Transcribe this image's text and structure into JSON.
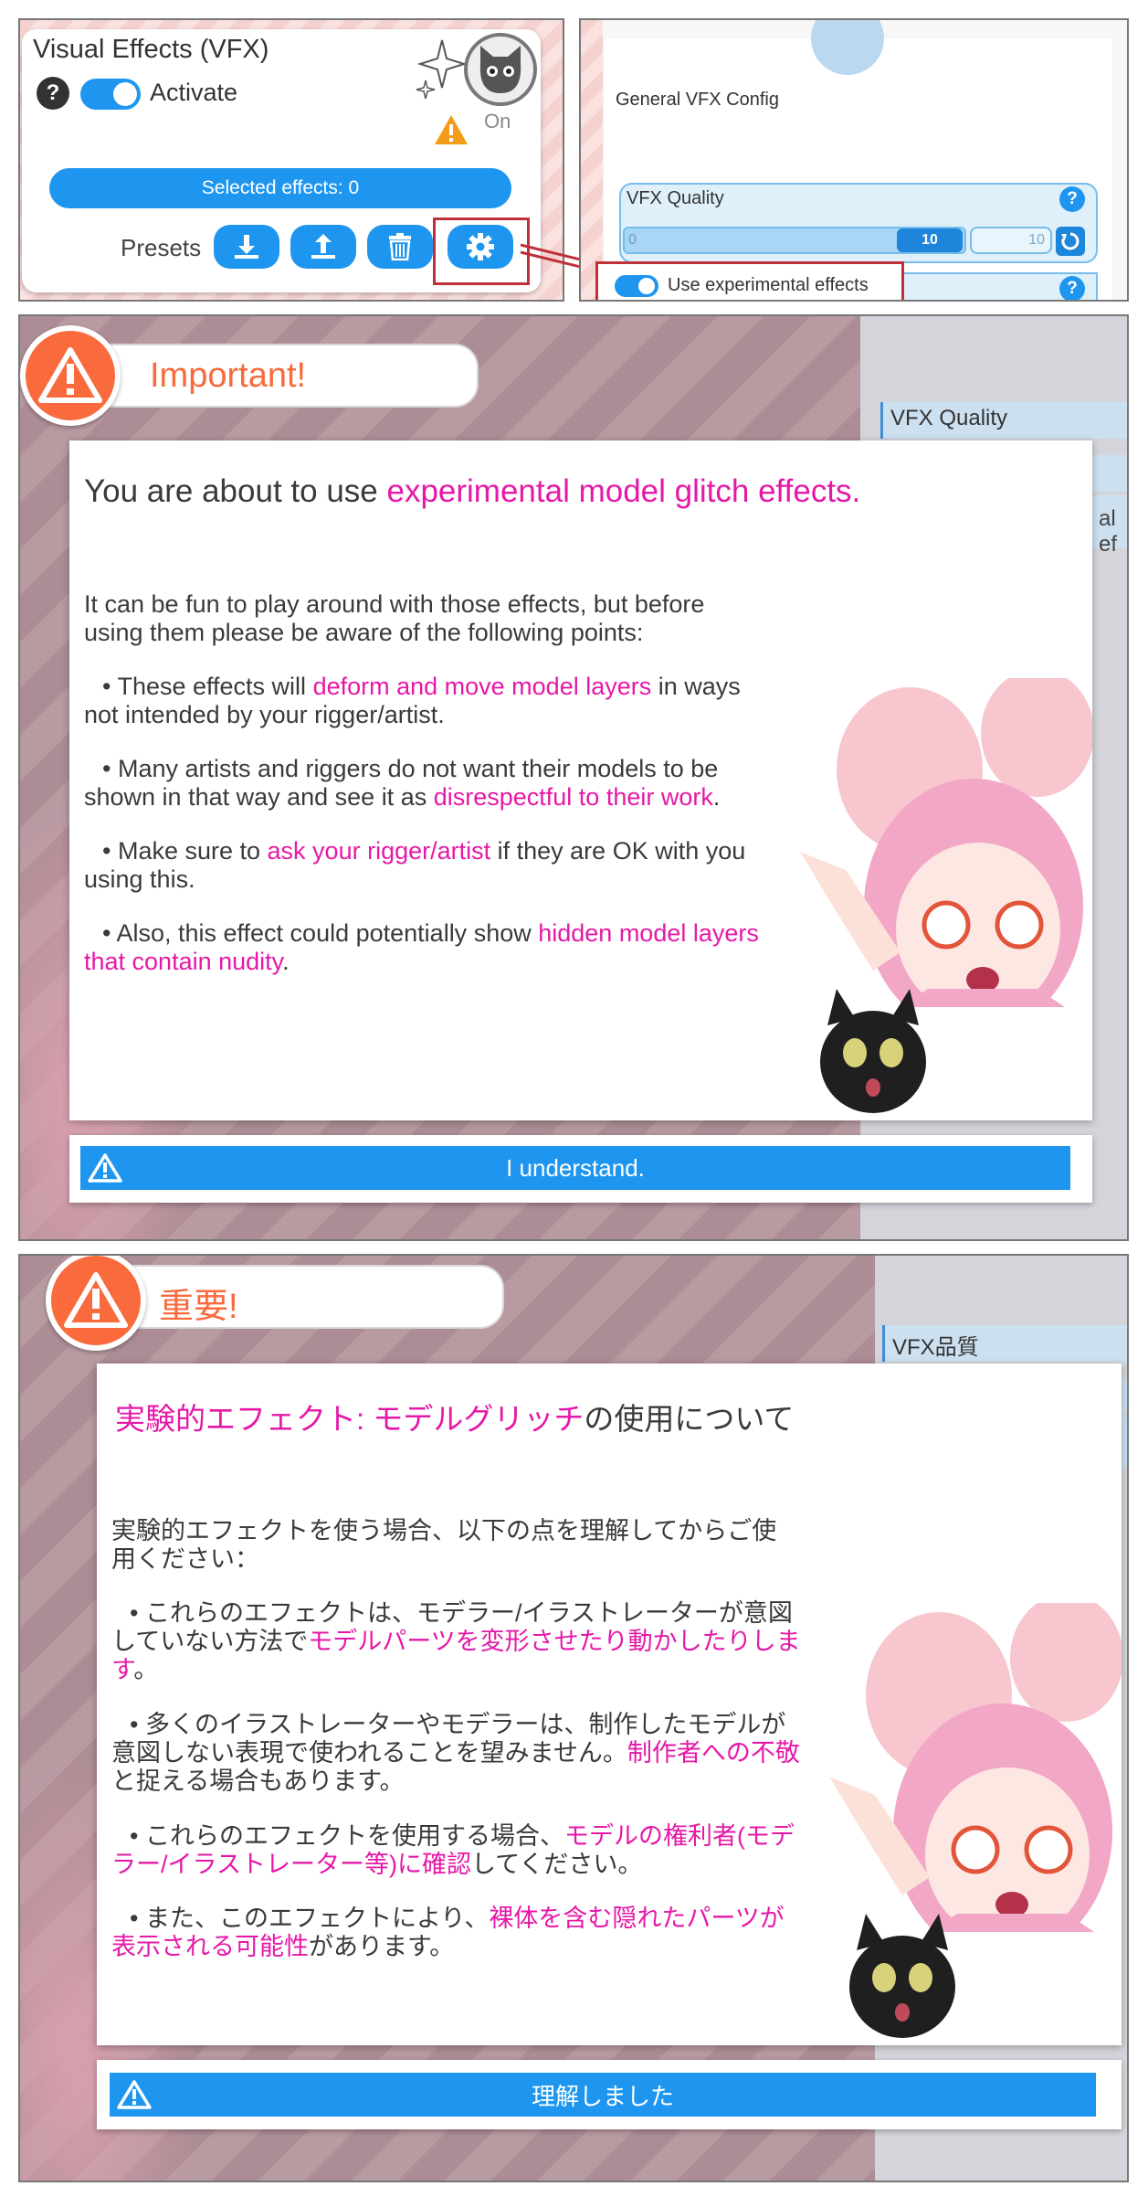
{
  "vfx_panel": {
    "title": "Visual Effects (VFX)",
    "help_label": "?",
    "activate_label": "Activate",
    "on_label": "On",
    "selected_effects_label": "Selected effects: 0",
    "presets_label": "Presets",
    "preset_buttons": [
      "download-icon",
      "upload-icon",
      "trash-icon",
      "gear-icon"
    ]
  },
  "config_panel": {
    "title": "General VFX Config",
    "quality_label": "VFX Quality",
    "quality_min": "0",
    "quality_value": "10",
    "quality_input": "10",
    "quality_level": 1.0,
    "experimental_label": "Use experimental effects",
    "help_label": "?"
  },
  "dialog_en": {
    "header": "Important!",
    "side_label": "VFX Quality",
    "side_peek": "al ef",
    "heading_plain": "You are about to use ",
    "heading_highlight": "experimental model glitch effects.",
    "intro": "It can be fun to play around with those effects, but before using them please be aware of the following points:",
    "b1_a": "• These effects will ",
    "b1_hl": "deform and move model layers",
    "b1_b": " in ways not intended by your rigger/artist.",
    "b2_a": "• Many artists and riggers do not want their models to be shown in that way and see it as ",
    "b2_hl": "disrespectful to their work",
    "b2_b": ".",
    "b3_a": "• Make sure to ",
    "b3_hl": "ask your rigger/artist",
    "b3_b": " if they are OK with you using this.",
    "b4_a": "• Also, this effect could potentially show ",
    "b4_hl": "hidden model layers that contain nudity",
    "b4_b": ".",
    "button": "I understand."
  },
  "dialog_jp": {
    "header": "重要!",
    "side_label": "VFX品質",
    "heading_highlight": "実験的エフェクト: モデルグリッチ",
    "heading_plain": "の使用について",
    "intro": "実験的エフェクトを使う場合、以下の点を理解してからご使用ください：",
    "b1_a": "• これらのエフェクトは、モデラー/イラストレーターが意図していない方法で",
    "b1_hl": "モデルパーツを変形させたり動かしたりします",
    "b1_b": "。",
    "b2_a": "• 多くのイラストレーターやモデラーは、制作したモデルが意図しない表現で使われることを望みません。",
    "b2_hl": "制作者への不敬",
    "b2_b": "と捉える場合もあります。",
    "b3_a": "• これらのエフェクトを使用する場合、",
    "b3_hl": "モデルの権利者(モデラー/イラストレーター等)に確認",
    "b3_b": "してください。",
    "b4_a": "• また、このエフェクトにより、",
    "b4_hl": "裸体を含む隠れたパーツが表示される可能性",
    "b4_b": "があります。",
    "button": "理解しました"
  },
  "colors": {
    "accent": "#1e96f0",
    "highlight": "#e618a8",
    "warning": "#f96a3c",
    "callout": "#c0303a"
  }
}
